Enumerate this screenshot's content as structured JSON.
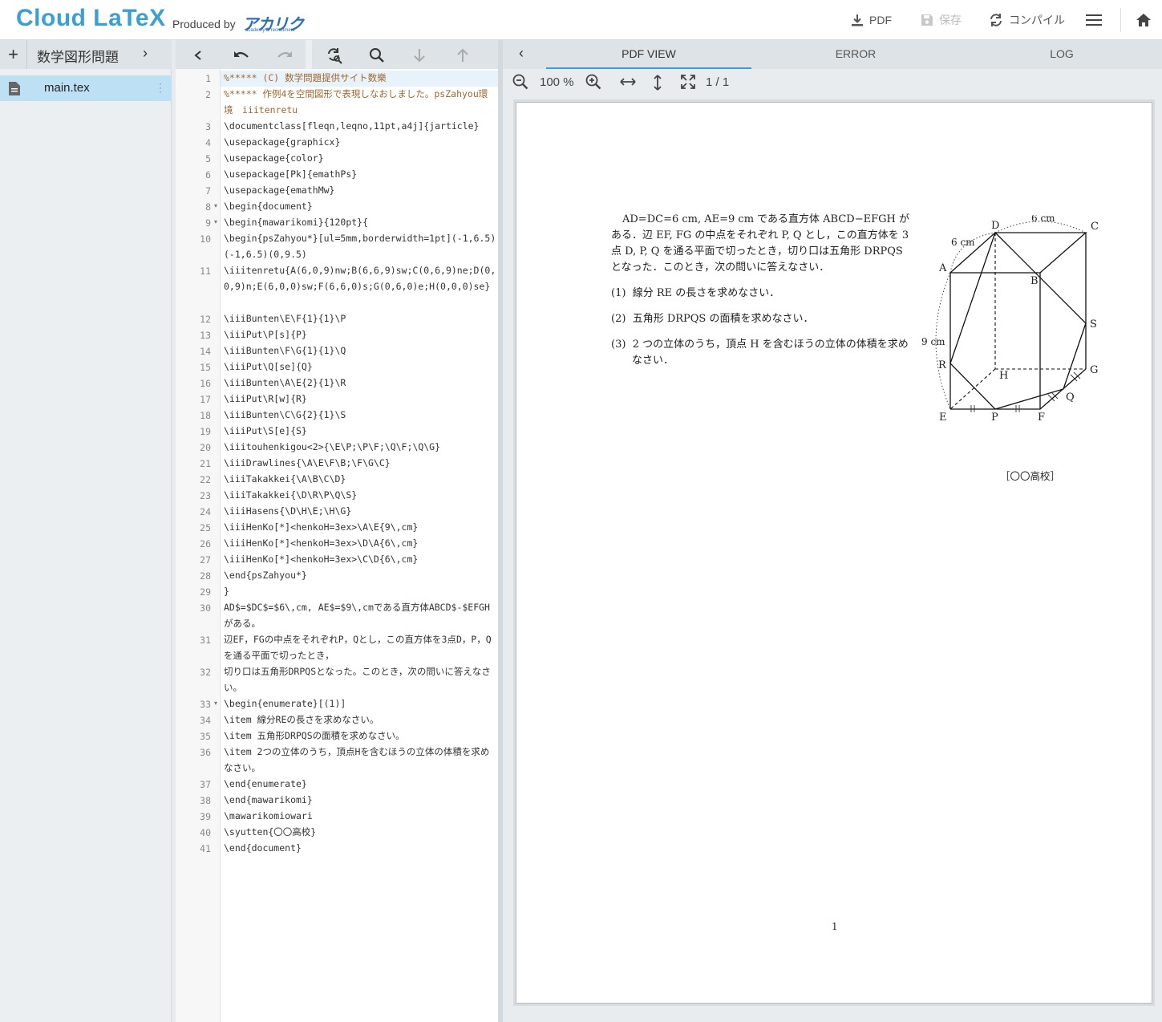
{
  "header": {
    "brand": "Cloud LaTeX",
    "produced_by": "Produced by",
    "partner_logo": "アカリク",
    "partner_sub": "academy & recruitment",
    "pdf_label": "PDF",
    "save_label": "保存",
    "compile_label": "コンパイル"
  },
  "sidebar": {
    "add": "+",
    "project_name": "数学図形問題",
    "files": [
      {
        "name": "main.tex"
      }
    ]
  },
  "editor": {
    "lines": [
      {
        "n": "1",
        "text": "%***** (C) 数学問題提供サイト数樂"
      },
      {
        "n": "2",
        "text": "%***** 作例4を空間図形で表現しなおしました。psZahyou環境　iiitenretu"
      },
      {
        "n": "3",
        "text": "\\documentclass[fleqn,leqno,11pt,a4j]{jarticle}"
      },
      {
        "n": "4",
        "text": "\\usepackage{graphicx}"
      },
      {
        "n": "5",
        "text": "\\usepackage{color}"
      },
      {
        "n": "6",
        "text": "\\usepackage[Pk]{emathPs}"
      },
      {
        "n": "7",
        "text": "\\usepackage{emathMw}"
      },
      {
        "n": "8",
        "text": "\\begin{document}"
      },
      {
        "n": "9",
        "text": "\\begin{mawarikomi}{120pt}{"
      },
      {
        "n": "10",
        "text": "\\begin{psZahyou*}[ul=5mm,borderwidth=1pt](-1,6.5)(-1,6.5)(0,9.5)"
      },
      {
        "n": "11",
        "text": "\\iiitenretu{A(6,0,9)nw;B(6,6,9)sw;C(0,6,9)ne;D(0,0,9)n;E(6,0,0)sw;F(6,6,0)s;G(0,6,0)e;H(0,0,0)se}"
      },
      {
        "n": "12",
        "text": "\\iiiBunten\\E\\F{1}{1}\\P"
      },
      {
        "n": "13",
        "text": "\\iiiPut\\P[s]{P}"
      },
      {
        "n": "14",
        "text": "\\iiiBunten\\F\\G{1}{1}\\Q"
      },
      {
        "n": "15",
        "text": "\\iiiPut\\Q[se]{Q}"
      },
      {
        "n": "16",
        "text": "\\iiiBunten\\A\\E{2}{1}\\R"
      },
      {
        "n": "17",
        "text": "\\iiiPut\\R[w]{R}"
      },
      {
        "n": "18",
        "text": "\\iiiBunten\\C\\G{2}{1}\\S"
      },
      {
        "n": "19",
        "text": "\\iiiPut\\S[e]{S}"
      },
      {
        "n": "20",
        "text": "\\iiitouhenkigou<2>{\\E\\P;\\P\\F;\\Q\\F;\\Q\\G}"
      },
      {
        "n": "21",
        "text": "\\iiiDrawlines{\\A\\E\\F\\B;\\F\\G\\C}"
      },
      {
        "n": "22",
        "text": "\\iiiTakakkei{\\A\\B\\C\\D}"
      },
      {
        "n": "23",
        "text": "\\iiiTakakkei{\\D\\R\\P\\Q\\S}"
      },
      {
        "n": "24",
        "text": "\\iiiHasens{\\D\\H\\E;\\H\\G}"
      },
      {
        "n": "25",
        "text": "\\iiiHenKo[*]<henkoH=3ex>\\A\\E{9\\,cm}"
      },
      {
        "n": "26",
        "text": "\\iiiHenKo[*]<henkoH=3ex>\\D\\A{6\\,cm}"
      },
      {
        "n": "27",
        "text": "\\iiiHenKo[*]<henkoH=3ex>\\C\\D{6\\,cm}"
      },
      {
        "n": "28",
        "text": "\\end{psZahyou*}"
      },
      {
        "n": "29",
        "text": "}"
      },
      {
        "n": "30",
        "text": "AD$=$DC$=$6\\,cm, AE$=$9\\,cmである直方体ABCD$-$EFGHがある。"
      },
      {
        "n": "31",
        "text": "辺EF，FGの中点をそれぞれP，Qとし，この直方体を3点D，P，Qを通る平面で切ったとき，"
      },
      {
        "n": "32",
        "text": "切り口は五角形DRPQSとなった。このとき，次の問いに答えなさい。"
      },
      {
        "n": "33",
        "text": "\\begin{enumerate}[(1)]"
      },
      {
        "n": "34",
        "text": "\\item 線分REの長さを求めなさい。"
      },
      {
        "n": "35",
        "text": "\\item 五角形DRPQSの面積を求めなさい。"
      },
      {
        "n": "36",
        "text": "\\item 2つの立体のうち，頂点Hを含むほうの立体の体積を求めなさい。"
      },
      {
        "n": "37",
        "text": "\\end{enumerate}"
      },
      {
        "n": "38",
        "text": "\\end{mawarikomi}"
      },
      {
        "n": "39",
        "text": "\\mawarikomiowari"
      },
      {
        "n": "40",
        "text": "\\syutten{〇〇高校}"
      },
      {
        "n": "41",
        "text": "\\end{document}"
      }
    ]
  },
  "pdf": {
    "tabs": [
      "PDF VIEW",
      "ERROR",
      "LOG"
    ],
    "zoom": "100 %",
    "page_indicator": "1 / 1",
    "problem": {
      "intro": "AD=DC=6 cm, AE=9 cm である直方体 ABCD−EFGH がある．辺 EF, FG の中点をそれぞれ P, Q とし，この直方体を 3 点 D, P, Q を通る平面で切ったとき，切り口は五角形 DRPQS となった．このとき，次の問いに答えなさい．",
      "q1_num": "(1)",
      "q1": "線分 RE の長さを求めなさい．",
      "q2_num": "(2)",
      "q2": "五角形 DRPQS の面積を求めなさい．",
      "q3_num": "(3)",
      "q3": "2 つの立体のうち，頂点 H を含むほうの立体の体積を求めなさい．"
    },
    "figure": {
      "A": "A",
      "B": "B",
      "C": "C",
      "D": "D",
      "E": "E",
      "F": "F",
      "G": "G",
      "H": "H",
      "P": "P",
      "Q": "Q",
      "R": "R",
      "S": "S",
      "len_AD": "6 cm",
      "len_DC": "6 cm",
      "len_AE": "9 cm"
    },
    "source": "［〇〇高校］",
    "page_number": "1"
  }
}
